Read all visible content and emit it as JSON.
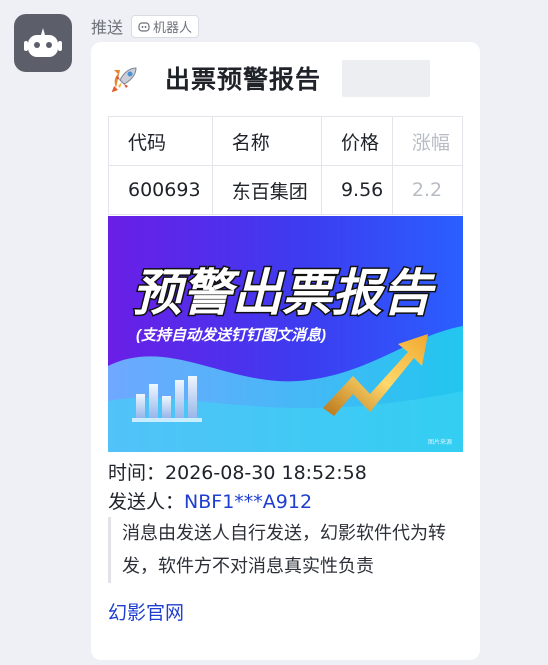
{
  "message": {
    "sender_name": "推送",
    "badge_label": "机器人",
    "avatar_icon": "robot-icon"
  },
  "card": {
    "title_icon": "rocket-icon",
    "title": "出票预警报告",
    "table": {
      "headers": [
        "代码",
        "名称",
        "价格",
        "涨幅"
      ],
      "rows": [
        [
          "600693",
          "东百集团",
          "9.56",
          "2.2"
        ]
      ]
    },
    "banner": {
      "headline": "预警出票报告",
      "subline": "(支持自动发送钉钉图文消息)",
      "corner_text": "图片来源"
    },
    "time_label": "时间：",
    "time_value": "2026-08-30 18:52:58",
    "sender_label": "发送人：",
    "sender_value": "NBF1***A912",
    "disclaimer": "消息由发送人自行发送，幻影软件代为转发，软件方不对消息真实性负责",
    "footer_link": "幻影官网"
  },
  "colors": {
    "link": "#1e3ed0",
    "banner_gradient": [
      "#6a1ee6",
      "#2f63ff",
      "#20c4ee"
    ],
    "avatar_bg": "#5c5f6a"
  }
}
